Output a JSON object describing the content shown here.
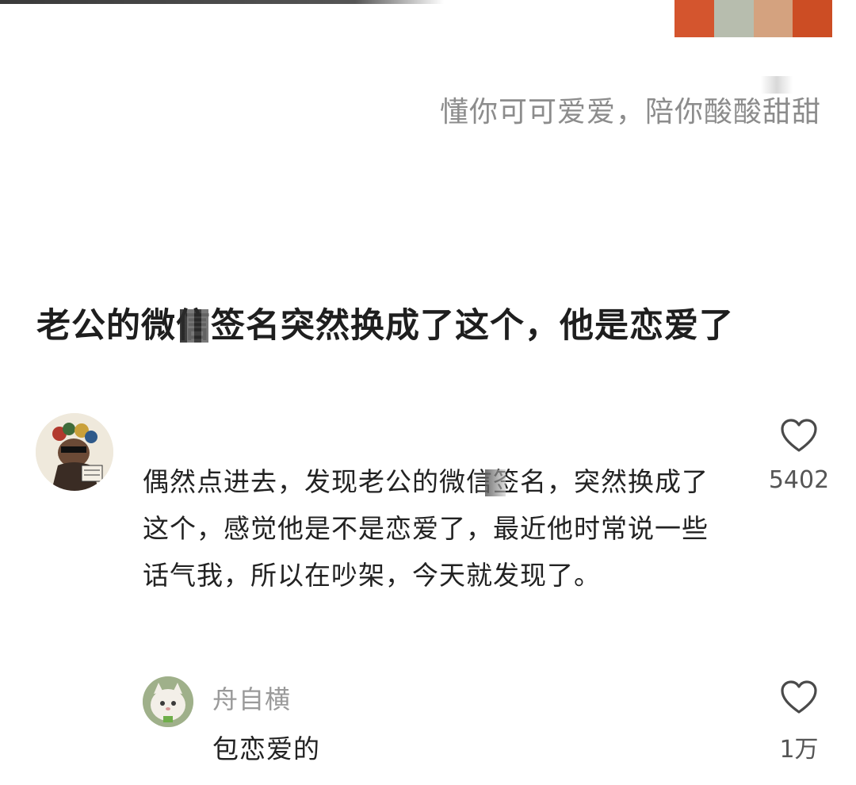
{
  "header": {
    "swatch_colors": [
      "#d4552e",
      "#b7bdae",
      "#d4a27f",
      "#cc4d24"
    ]
  },
  "profile": {
    "signature": "懂你可可爱爱，陪你酸酸甜甜"
  },
  "post": {
    "title": "老公的微信签名突然换成了这个，他是恋爱了"
  },
  "comment": {
    "avatar_icon": "avatar-illustration-icon",
    "text": "偶然点进去，发现老公的微信签名，突然换成了这个，感觉他是不是恋爱了，最近他时常说一些话气我，所以在吵架，今天就发现了。",
    "like_icon": "heart-outline-icon",
    "like_count": "5402"
  },
  "reply": {
    "avatar_icon": "avatar-cat-icon",
    "username": "舟自横",
    "text": "包恋爱的",
    "like_icon": "heart-outline-icon",
    "like_count": "1万"
  }
}
